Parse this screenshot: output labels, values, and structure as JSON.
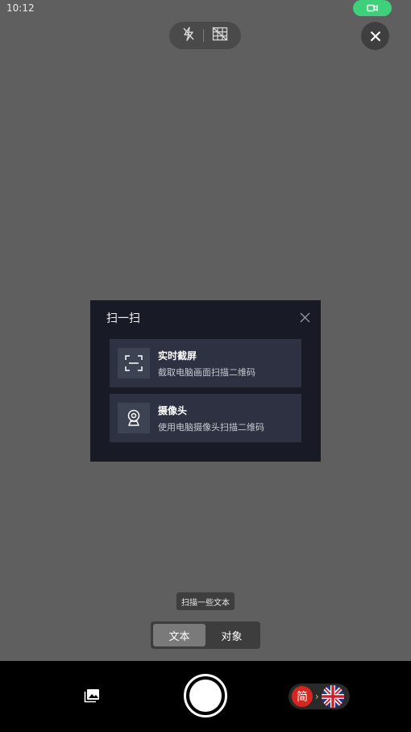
{
  "status_bar": {
    "time": "10:12",
    "recording_icon": "video-camera-icon",
    "recording_color": "#3fd07a"
  },
  "camera_controls": {
    "flash_icon": "flash-off-icon",
    "grid_icon": "grid-off-icon",
    "close_icon": "close-icon"
  },
  "dialog": {
    "title": "扫一扫",
    "close_icon": "close-icon",
    "options": [
      {
        "icon": "screenshot-frame-icon",
        "title": "实时截屏",
        "subtitle": "截取电脑画面扫描二维码"
      },
      {
        "icon": "webcam-icon",
        "title": "摄像头",
        "subtitle": "使用电脑摄像头扫描二维码"
      }
    ]
  },
  "hint": "扫描一些文本",
  "mode_tabs": [
    {
      "label": "文本",
      "active": true
    },
    {
      "label": "对象",
      "active": false
    }
  ],
  "bottom_bar": {
    "gallery_icon": "gallery-icon",
    "shutter_icon": "shutter-button",
    "source_language": "简",
    "arrow": "›",
    "target_language_icon": "uk-flag-icon"
  },
  "colors": {
    "camera_background": "#5f5f5f",
    "dialog_background": "#181b25",
    "option_background": "#2d3142",
    "accent_red": "#d7261f"
  }
}
